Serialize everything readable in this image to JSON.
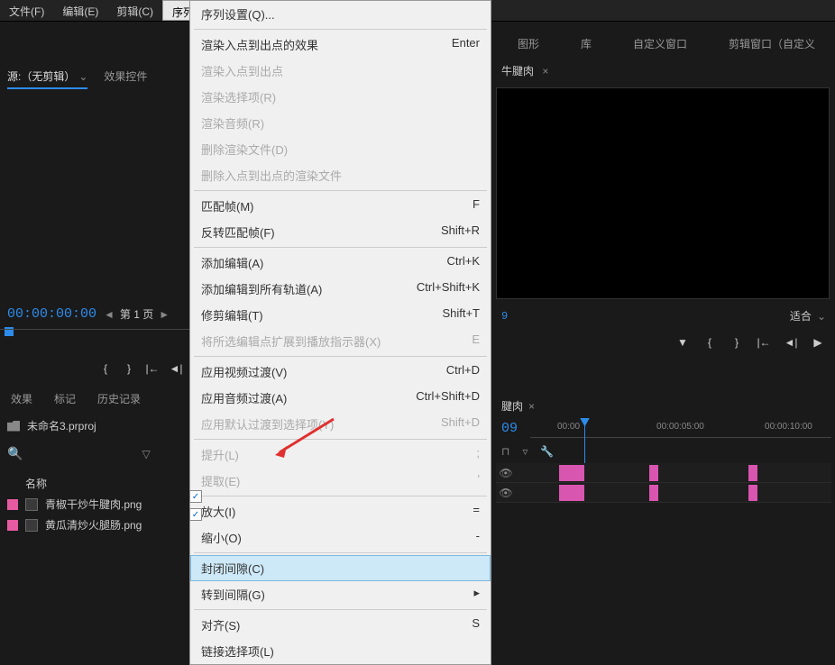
{
  "menubar": {
    "file": "文件(F)",
    "edit": "编辑(E)",
    "clip": "剪辑(C)",
    "sequence": "序列(S)"
  },
  "top_tabs": {
    "graphics": "图形",
    "library": "库",
    "custom_window": "自定义窗口",
    "clip_window": "剪辑窗口（自定义"
  },
  "dropdown": {
    "seq_settings": "序列设置(Q)...",
    "render_in_out_effects": "渲染入点到出点的效果",
    "render_in_out_effects_key": "Enter",
    "render_in_out": "渲染入点到出点",
    "render_selection": "渲染选择项(R)",
    "render_audio": "渲染音频(R)",
    "delete_render": "删除渲染文件(D)",
    "delete_render_in_out": "删除入点到出点的渲染文件",
    "match_frame": "匹配帧(M)",
    "match_frame_key": "F",
    "reverse_match": "反转匹配帧(F)",
    "reverse_match_key": "Shift+R",
    "add_edit": "添加编辑(A)",
    "add_edit_key": "Ctrl+K",
    "add_edit_all": "添加编辑到所有轨道(A)",
    "add_edit_all_key": "Ctrl+Shift+K",
    "trim_edit": "修剪编辑(T)",
    "trim_edit_key": "Shift+T",
    "extend_edit": "将所选编辑点扩展到播放指示器(X)",
    "extend_edit_key": "E",
    "apply_video": "应用视频过渡(V)",
    "apply_video_key": "Ctrl+D",
    "apply_audio": "应用音频过渡(A)",
    "apply_audio_key": "Ctrl+Shift+D",
    "apply_default": "应用默认过渡到选择项(Y)",
    "apply_default_key": "Shift+D",
    "lift": "提升(L)",
    "lift_key": ";",
    "extract": "提取(E)",
    "extract_key": "'",
    "zoom_in": "放大(I)",
    "zoom_in_key": "=",
    "zoom_out": "缩小(O)",
    "zoom_out_key": "-",
    "close_gap": "封闭间隙(C)",
    "go_to_gap": "转到间隔(G)",
    "snap": "对齐(S)",
    "snap_key": "S",
    "linked_sel": "链接选择项(L)"
  },
  "source": {
    "tab1": "源:（无剪辑）",
    "tab2": "效果控件"
  },
  "timecode_source": "00:00:00:00",
  "page_label": "第 1 页",
  "bottom_tabs": {
    "effects": "效果",
    "markers": "标记",
    "history": "历史记录"
  },
  "project_name": "未命名3.prproj",
  "bin_header": "名称",
  "bin_items": [
    "青椒干炒牛腱肉.png",
    "黄瓜清炒火腿肠.png"
  ],
  "program": {
    "title_suffix": "牛腱肉",
    "fit": "适合"
  },
  "right_timecode": "9",
  "timeline": {
    "title_suffix": "腱肉",
    "timecode": "09",
    "ruler": [
      "00:00",
      "00:00:05:00",
      "00:00:10:00"
    ]
  }
}
